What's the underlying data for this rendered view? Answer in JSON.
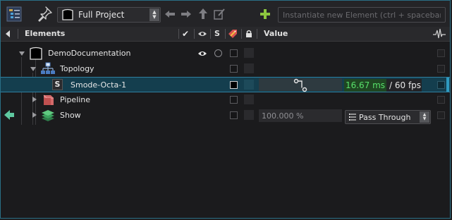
{
  "toolbar": {
    "project_label": "Full Project",
    "search_placeholder": "Instantiate new Element (ctrl + spacebar)",
    "icons": [
      "tree-menu-icon",
      "pin-icon",
      "project-shield-icon",
      "arrow-left-icon",
      "arrow-right-icon",
      "arrow-up-icon",
      "edit-icon",
      "add-icon"
    ]
  },
  "header": {
    "elements_label": "Elements",
    "s_label": "S",
    "value_label": "Value"
  },
  "tree": {
    "root": {
      "label": "DemoDocumentation"
    },
    "topology": {
      "label": "Topology"
    },
    "smode": {
      "badge": "S",
      "label": "Smode-Octa-1",
      "ms": "16.67 ms",
      "fps": "/ 60 fps"
    },
    "pipeline": {
      "label": "Pipeline"
    },
    "show": {
      "label": "Show",
      "value": "100.000 %",
      "blend_mode": "Pass Through"
    }
  },
  "colors": {
    "accent": "#2f7fa0",
    "selection": "#143e4e",
    "perf_green": "#58e06a",
    "add_green": "#8cc63f",
    "show_arrow": "#5fc9a0"
  }
}
